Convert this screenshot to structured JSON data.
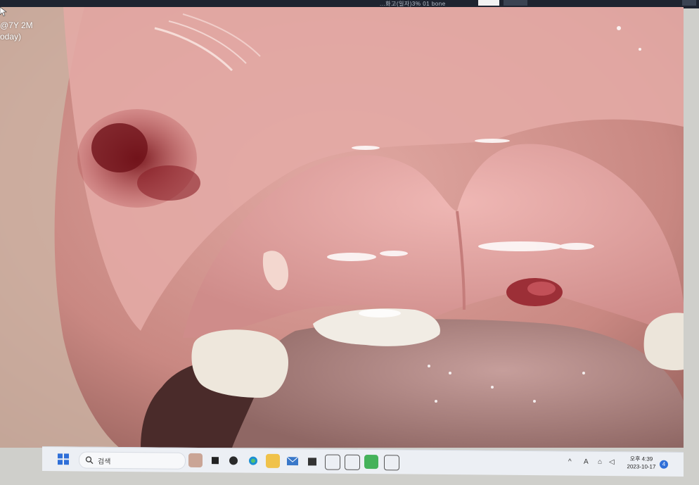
{
  "window": {
    "tab_text": "...화고(일자)3% 01 bone",
    "overlay_age": "@7Y 2M",
    "overlay_date_suffix": "oday)"
  },
  "taskbar": {
    "search_placeholder": "검색",
    "tray_ime": "A",
    "clock_time": "오후 4:39",
    "clock_date": "2023-10-17",
    "notification_count": "4",
    "icons": [
      "windows-start-icon",
      "search-icon",
      "file-icon",
      "widget-icon",
      "chat-icon",
      "edge-icon",
      "folder-icon",
      "mail-icon",
      "store-icon",
      "app-icon",
      "app-icon-2",
      "app-icon-3",
      "app-icon-4"
    ]
  },
  "colors": {
    "tissue": "#c98a85",
    "gum": "#d99a98",
    "tooth": "#eee7dc",
    "blood": "#7a1f25",
    "taskbar": "#eceff4",
    "accent": "#2f6fd8"
  }
}
